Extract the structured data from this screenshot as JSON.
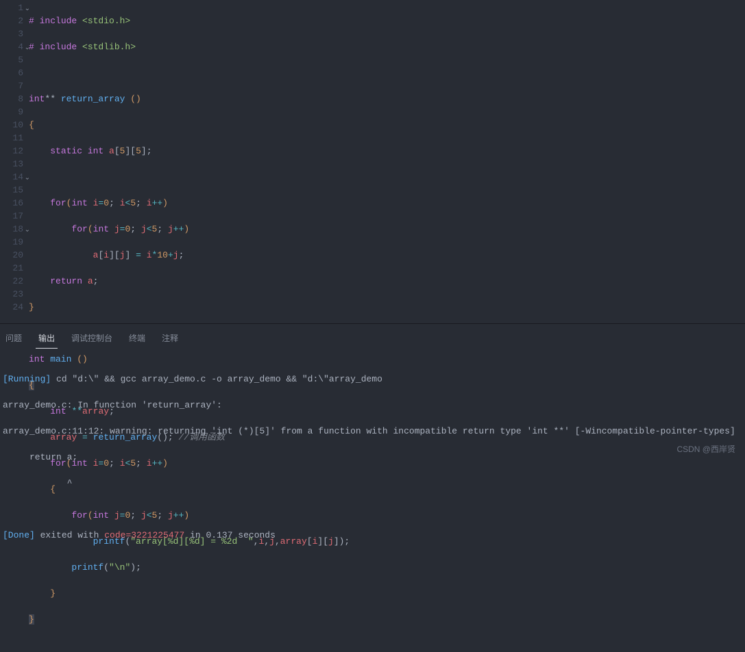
{
  "editor": {
    "lines": [
      {
        "n": "1",
        "fold": true
      },
      {
        "n": "2"
      },
      {
        "n": "3"
      },
      {
        "n": "4",
        "fold": true
      },
      {
        "n": "5"
      },
      {
        "n": "6"
      },
      {
        "n": "7"
      },
      {
        "n": "8"
      },
      {
        "n": "9"
      },
      {
        "n": "10"
      },
      {
        "n": "11"
      },
      {
        "n": "12"
      },
      {
        "n": "13"
      },
      {
        "n": "14",
        "fold": true
      },
      {
        "n": "15"
      },
      {
        "n": "16"
      },
      {
        "n": "17"
      },
      {
        "n": "18",
        "fold": true
      },
      {
        "n": "19"
      },
      {
        "n": "20"
      },
      {
        "n": "21"
      },
      {
        "n": "22"
      },
      {
        "n": "23"
      },
      {
        "n": "24"
      }
    ],
    "code": {
      "l1_pre": "# ",
      "l1_inc": "include",
      "l1_post": " <stdio.h>",
      "l2_pre": "# ",
      "l2_inc": "include",
      "l2_post": " <stdlib.h>",
      "l4_t1": "int",
      "l4_t2": "**",
      "l4_fn": " return_array ",
      "l4_p": "()",
      "l5": "{",
      "l6_kw": "static",
      "l6_ty": " int",
      "l6_id": " a",
      "l6_br": "[",
      "l6_n1": "5",
      "l6_br2": "][",
      "l6_n2": "5",
      "l6_br3": "]",
      "l6_sc": ";",
      "l8_for": "for",
      "l8_p1": "(",
      "l8_ty": "int",
      "l8_sp": " ",
      "l8_i": "i",
      "l8_eq": "=",
      "l8_n0": "0",
      "l8_sc": "; ",
      "l8_i2": "i",
      "l8_lt": "<",
      "l8_n5": "5",
      "l8_sc2": "; ",
      "l8_i3": "i",
      "l8_pp": "++",
      "l8_p2": ")",
      "l9_for": "for",
      "l9_p1": "(",
      "l9_ty": "int",
      "l9_sp": " ",
      "l9_j": "j",
      "l9_eq": "=",
      "l9_n0": "0",
      "l9_sc": "; ",
      "l9_j2": "j",
      "l9_lt": "<",
      "l9_n5": "5",
      "l9_sc2": "; ",
      "l9_j3": "j",
      "l9_pp": "++",
      "l9_p2": ")",
      "l10_a": "a",
      "l10_b1": "[",
      "l10_i": "i",
      "l10_b2": "][",
      "l10_j": "j",
      "l10_b3": "]",
      "l10_eq": " = ",
      "l10_i2": "i",
      "l10_m": "*",
      "l10_n10": "10",
      "l10_p": "+",
      "l10_j2": "j",
      "l10_sc": ";",
      "l11_ret": "return",
      "l11_sp": " ",
      "l11_a": "a",
      "l11_sc": ";",
      "l12": "}",
      "l14_ty": "int",
      "l14_fn": " main ",
      "l14_p": "()",
      "l15": "{",
      "l16_ty": "int",
      "l16_sp": " ",
      "l16_ss": "**",
      "l16_id": "array",
      "l16_sc": ";",
      "l17_id": "array",
      "l17_eq": " = ",
      "l17_fn": "return_array",
      "l17_p": "(); ",
      "l17_cm": "//调用函数",
      "l18_for": "for",
      "l18_p1": "(",
      "l18_ty": "int",
      "l18_sp": " ",
      "l18_i": "i",
      "l18_eq": "=",
      "l18_n0": "0",
      "l18_sc": "; ",
      "l18_i2": "i",
      "l18_lt": "<",
      "l18_n5": "5",
      "l18_sc2": "; ",
      "l18_i3": "i",
      "l18_pp": "++",
      "l18_p2": ")",
      "l19": "{",
      "l20_for": "for",
      "l20_p1": "(",
      "l20_ty": "int",
      "l20_sp": " ",
      "l20_j": "j",
      "l20_eq": "=",
      "l20_n0": "0",
      "l20_sc": "; ",
      "l20_j2": "j",
      "l20_lt": "<",
      "l20_n5": "5",
      "l20_sc2": "; ",
      "l20_j3": "j",
      "l20_pp": "++",
      "l20_p2": ")",
      "l21_fn": "printf",
      "l21_p1": "(",
      "l21_s": "\"array[%d][%d] = %2d  \"",
      "l21_c": ",",
      "l21_i": "i",
      "l21_c2": ",",
      "l21_j": "j",
      "l21_c3": ",",
      "l21_a": "array",
      "l21_b1": "[",
      "l21_i2": "i",
      "l21_b2": "][",
      "l21_j2": "j",
      "l21_b3": "]",
      "l21_p2": ");",
      "l22_fn": "printf",
      "l22_p1": "(",
      "l22_s": "\"\\n\"",
      "l22_p2": ");",
      "l23": "}",
      "l24": "}"
    }
  },
  "panel": {
    "tabs": {
      "problems": "问题",
      "output": "输出",
      "debug": "调试控制台",
      "terminal": "终端",
      "comments": "注释"
    },
    "out": {
      "running_lbl": "[Running]",
      "running_cmd": " cd \"d:\\\" && gcc array_demo.c -o array_demo && \"d:\\\"array_demo",
      "w1": "array_demo.c: In function 'return_array':",
      "w2": "array_demo.c:11:12: warning: returning 'int (*)[5]' from a function with incompatible return type 'int **' [-Wincompatible-pointer-types]",
      "w3": "     return a;",
      "w4": "            ^",
      "done_lbl": "[Done]",
      "done_t1": " exited with ",
      "done_code": "code=3221225477",
      "done_t2": " in ",
      "done_time": "0.137",
      "done_t3": " seconds"
    }
  },
  "watermark": "CSDN @西岸贤"
}
